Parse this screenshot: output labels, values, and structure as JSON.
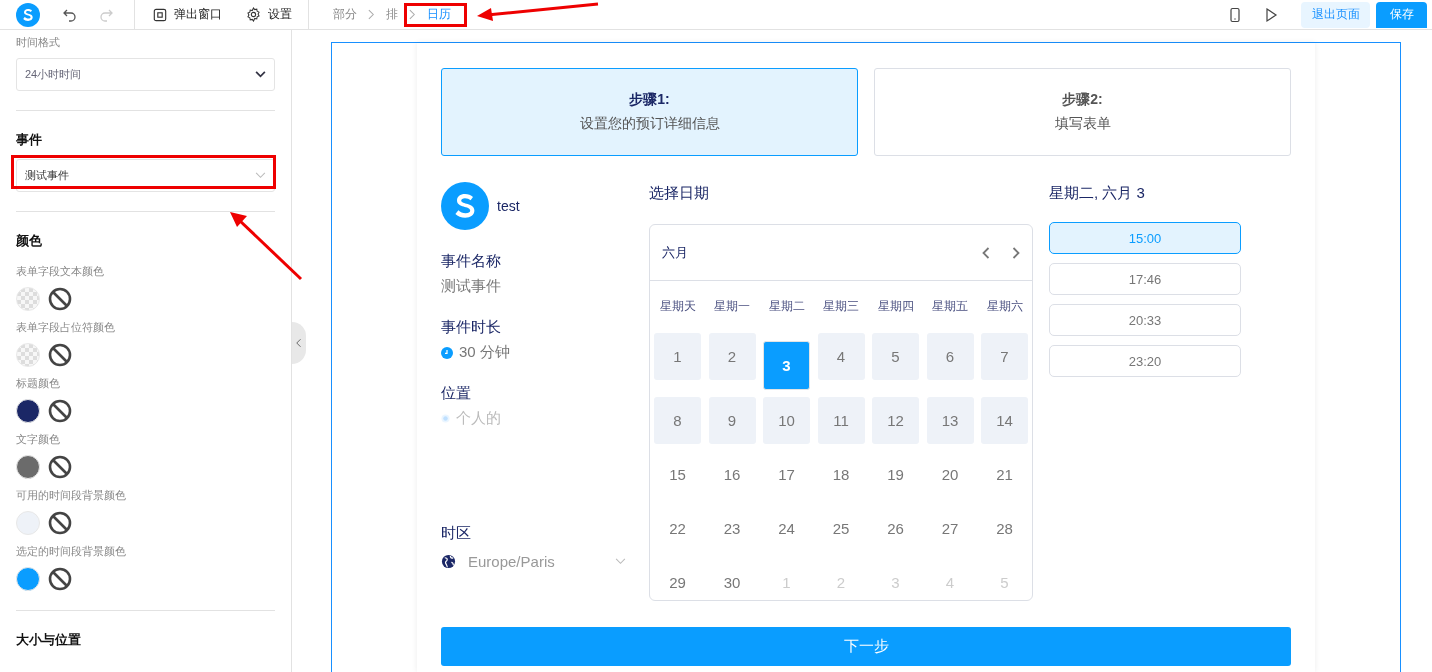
{
  "toolbar": {
    "popup": "弹出窗口",
    "settings": "设置",
    "breadcrumbs": [
      {
        "label": "部分",
        "selected": false
      },
      {
        "label": "排",
        "selected": false
      },
      {
        "label": "日历",
        "selected": true
      }
    ],
    "exit": "退出页面",
    "save": "保存"
  },
  "sidebar": {
    "time_format": {
      "label": "时间格式",
      "value": "24小时时间"
    },
    "event": {
      "heading": "事件",
      "value": "测试事件"
    },
    "colors_heading": "颜色",
    "colors": [
      {
        "label": "表单字段文本颜色",
        "kind": "transparent"
      },
      {
        "label": "表单字段占位符颜色",
        "kind": "transparent"
      },
      {
        "label": "标题颜色",
        "kind": "solid",
        "color": "#1b2766"
      },
      {
        "label": "文字颜色",
        "kind": "solid",
        "color": "#6b6b6b"
      },
      {
        "label": "可用的时间段背景颜色",
        "kind": "solid",
        "color": "#eef2f8"
      },
      {
        "label": "选定的时间段背景颜色",
        "kind": "solid",
        "color": "#0a9dff"
      }
    ],
    "size_heading": "大小与位置"
  },
  "steps": [
    {
      "title": "步骤1:",
      "subtitle": "设置您的预订详细信息",
      "selected": true
    },
    {
      "title": "步骤2:",
      "subtitle": "填写表单",
      "selected": false
    }
  ],
  "profile": {
    "name": "test"
  },
  "details": [
    {
      "label": "事件名称",
      "value": "测试事件",
      "kind": "plain"
    },
    {
      "label": "事件时长",
      "value": "30 分钟",
      "kind": "duration"
    },
    {
      "label": "位置",
      "value": "个人的",
      "kind": "location"
    }
  ],
  "timezone": {
    "label": "时区",
    "value": "Europe/Paris"
  },
  "calendar": {
    "heading": "选择日期",
    "month": "六月",
    "weekdays": [
      "星期天",
      "星期一",
      "星期二",
      "星期三",
      "星期四",
      "星期五",
      "星期六"
    ],
    "days": [
      {
        "label": "1",
        "kind": "available",
        "selected": false
      },
      {
        "label": "2",
        "kind": "available",
        "selected": false
      },
      {
        "label": "3",
        "kind": "available",
        "selected": true
      },
      {
        "label": "4",
        "kind": "available",
        "selected": false
      },
      {
        "label": "5",
        "kind": "available",
        "selected": false
      },
      {
        "label": "6",
        "kind": "available",
        "selected": false
      },
      {
        "label": "7",
        "kind": "available",
        "selected": false
      },
      {
        "label": "8",
        "kind": "available",
        "selected": false
      },
      {
        "label": "9",
        "kind": "available",
        "selected": false
      },
      {
        "label": "10",
        "kind": "available",
        "selected": false
      },
      {
        "label": "11",
        "kind": "available",
        "selected": false
      },
      {
        "label": "12",
        "kind": "available",
        "selected": false
      },
      {
        "label": "13",
        "kind": "available",
        "selected": false
      },
      {
        "label": "14",
        "kind": "available",
        "selected": false
      },
      {
        "label": "15",
        "kind": "plain",
        "selected": false
      },
      {
        "label": "16",
        "kind": "plain",
        "selected": false
      },
      {
        "label": "17",
        "kind": "plain",
        "selected": false
      },
      {
        "label": "18",
        "kind": "plain",
        "selected": false
      },
      {
        "label": "19",
        "kind": "plain",
        "selected": false
      },
      {
        "label": "20",
        "kind": "plain",
        "selected": false
      },
      {
        "label": "21",
        "kind": "plain",
        "selected": false
      },
      {
        "label": "22",
        "kind": "plain",
        "selected": false
      },
      {
        "label": "23",
        "kind": "plain",
        "selected": false
      },
      {
        "label": "24",
        "kind": "plain",
        "selected": false
      },
      {
        "label": "25",
        "kind": "plain",
        "selected": false
      },
      {
        "label": "26",
        "kind": "plain",
        "selected": false
      },
      {
        "label": "27",
        "kind": "plain",
        "selected": false
      },
      {
        "label": "28",
        "kind": "plain",
        "selected": false
      },
      {
        "label": "29",
        "kind": "plain",
        "selected": false
      },
      {
        "label": "30",
        "kind": "plain",
        "selected": false
      },
      {
        "label": "1",
        "kind": "other",
        "selected": false
      },
      {
        "label": "2",
        "kind": "other",
        "selected": false
      },
      {
        "label": "3",
        "kind": "other",
        "selected": false
      },
      {
        "label": "4",
        "kind": "other",
        "selected": false
      },
      {
        "label": "5",
        "kind": "other",
        "selected": false
      }
    ]
  },
  "slots": {
    "heading": "星期二, 六月 3",
    "times": [
      {
        "label": "15:00",
        "selected": true
      },
      {
        "label": "17:46",
        "selected": false
      },
      {
        "label": "20:33",
        "selected": false
      },
      {
        "label": "23:20",
        "selected": false
      }
    ]
  },
  "next": "下一步"
}
